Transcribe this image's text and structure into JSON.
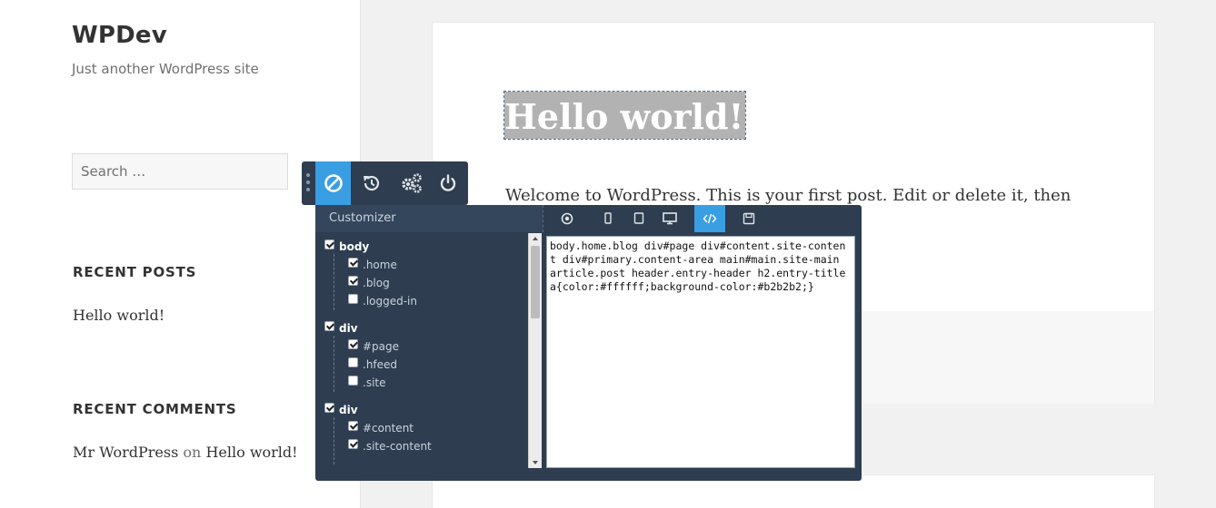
{
  "site": {
    "title": "WPDev",
    "tagline": "Just another WordPress site"
  },
  "search": {
    "placeholder": "Search …"
  },
  "widgets": {
    "recent_posts_title": "RECENT POSTS",
    "recent_posts": [
      "Hello world!"
    ],
    "recent_comments_title": "RECENT COMMENTS",
    "comment": {
      "author": "Mr WordPress",
      "on": "on",
      "post": "Hello world!"
    }
  },
  "article": {
    "title": "Hello world!",
    "excerpt": "Welcome to WordPress. This is your first post. Edit or delete it, then"
  },
  "toolbar": {
    "buttons": [
      "disable-icon",
      "history-icon",
      "settings-icon",
      "power-icon"
    ],
    "active_color": "#3a9ee3"
  },
  "customizer": {
    "title": "Customizer",
    "tabs": [
      "target-icon",
      "phone-icon",
      "tablet-icon",
      "desktop-icon",
      "code-icon",
      "save-icon"
    ],
    "active_tab": "code-icon",
    "tree": [
      {
        "label": "body",
        "checked": true,
        "children": [
          {
            "label": ".home",
            "checked": true
          },
          {
            "label": ".blog",
            "checked": true
          },
          {
            "label": ".logged-in",
            "checked": false
          }
        ]
      },
      {
        "label": "div",
        "checked": true,
        "children": [
          {
            "label": "#page",
            "checked": true
          },
          {
            "label": ".hfeed",
            "checked": false
          },
          {
            "label": ".site",
            "checked": false
          }
        ]
      },
      {
        "label": "div",
        "checked": true,
        "children": [
          {
            "label": "#content",
            "checked": true
          },
          {
            "label": ".site-content",
            "checked": true
          }
        ]
      }
    ],
    "css_code": "body.home.blog div#page div#content.site-content div#primary.content-area main#main.site-main article.post header.entry-header h2.entry-title a{color:#ffffff;background-color:#b2b2b2;}"
  },
  "colors": {
    "panel_bg": "#2e3d50",
    "accent": "#3a9ee3",
    "highlight_bg": "#b2b2b2"
  }
}
